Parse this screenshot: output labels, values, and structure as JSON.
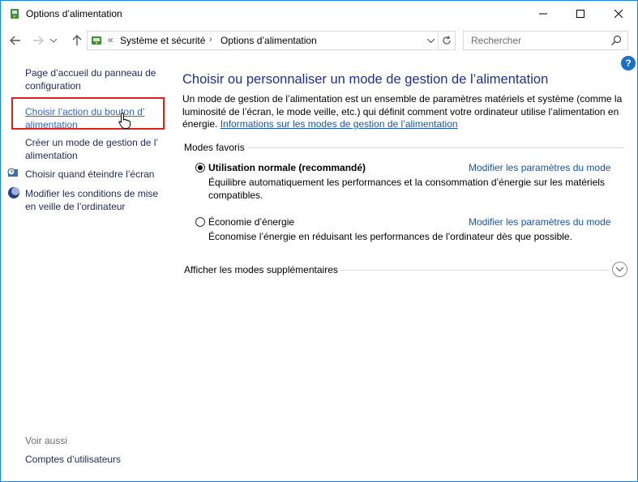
{
  "window": {
    "title": "Options d’alimentation",
    "controls": {
      "minimize": "minimize-icon",
      "maximize": "maximize-icon",
      "close": "close-icon"
    }
  },
  "nav": {
    "breadcrumb_prefix": "«",
    "breadcrumbs": [
      "Système et sécurité",
      "Options d’alimentation"
    ],
    "search_placeholder": "Rechercher"
  },
  "help": {
    "label": "?"
  },
  "sidebar": {
    "tasks": [
      {
        "label_line1": "Page d’accueil du panneau de",
        "label_line2": "configuration"
      },
      {
        "label_line1": "Choisir l’action du bouton d’",
        "label_line2": "alimentation"
      },
      {
        "label_line1": "Créer un mode de gestion de l’",
        "label_line2": "alimentation"
      },
      {
        "label_line1": "Choisir quand éteindre l’écran"
      },
      {
        "label_line1": "Modifier les conditions de mise",
        "label_line2": "en veille de l’ordinateur"
      }
    ],
    "see_also_label": "Voir aussi",
    "see_also_links": [
      "Comptes d’utilisateurs"
    ]
  },
  "main": {
    "title": "Choisir ou personnaliser un mode de gestion de l’alimentation",
    "intro_text": "Un mode de gestion de l’alimentation est un ensemble de paramètres matériels et système (comme la luminosité de l’écran, le mode veille, etc.) qui définit comment votre ordinateur utilise l’alimentation en énergie.",
    "intro_link": "Informations sur les modes de gestion de l’alimentation",
    "favorites_label": "Modes favoris",
    "plans": [
      {
        "name": "Utilisation normale (recommandé)",
        "selected": true,
        "change_label": "Modifier les paramètres du mode",
        "description": "Équilibre automatiquement les performances et la consommation d’énergie sur les matériels compatibles."
      },
      {
        "name": "Économie d’énergie",
        "selected": false,
        "change_label": "Modifier les paramètres du mode",
        "description": "Économise l’énergie en réduisant les performances de l’ordinateur dès que possible."
      }
    ],
    "more_label": "Afficher les modes supplémentaires"
  },
  "colors": {
    "accent_link": "#1a55a7",
    "title_blue": "#1e3287",
    "highlight_box": "#e0201b",
    "window_border": "#1883d7"
  }
}
